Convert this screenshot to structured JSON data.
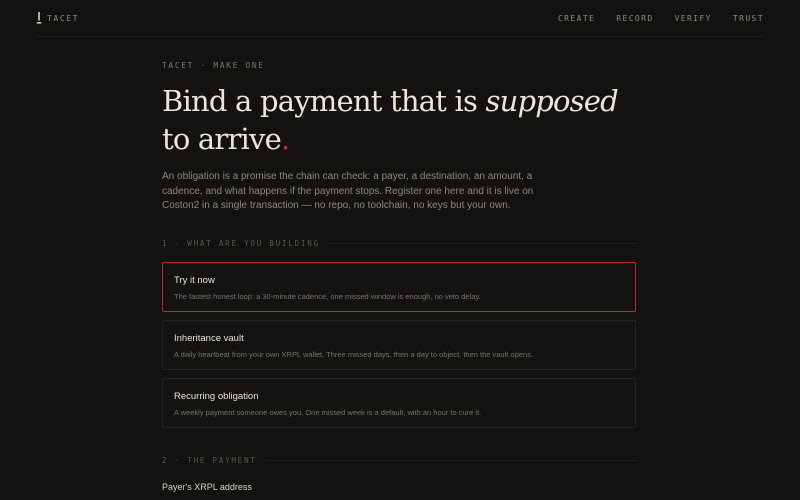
{
  "header": {
    "brand": "TACET",
    "nav": [
      "CREATE",
      "RECORD",
      "VERIFY",
      "TRUST"
    ]
  },
  "hero": {
    "eyebrow": "TACET · MAKE ONE",
    "headline_part1": "Bind a payment that is ",
    "headline_emphasis": "supposed",
    "headline_part2": " to arrive",
    "headline_dot": ".",
    "lede": "An obligation is a promise the chain can check: a payer, a destination, an amount, a cadence, and what happens if the payment stops. Register one here and it is live on Coston2 in a single transaction — no repo, no toolchain, no keys but your own."
  },
  "sections": [
    {
      "label": "1 · WHAT ARE YOU BUILDING"
    },
    {
      "label": "2 · THE PAYMENT"
    }
  ],
  "options": [
    {
      "title": "Try it now",
      "desc": "The fastest honest loop: a 30-minute cadence, one missed window is enough, no veto delay.",
      "selected": true
    },
    {
      "title": "Inheritance vault",
      "desc": "A daily heartbeat from your own XRPL wallet. Three missed days, then a day to object, then the vault opens.",
      "selected": false
    },
    {
      "title": "Recurring obligation",
      "desc": "A weekly payment someone owes you. One missed week is a default, with an hour to cure it.",
      "selected": false
    }
  ],
  "payment": {
    "payer_label": "Payer's XRPL address"
  },
  "colors": {
    "background": "#141210",
    "accent": "#d8283a",
    "selected_border": "#b82a32"
  }
}
